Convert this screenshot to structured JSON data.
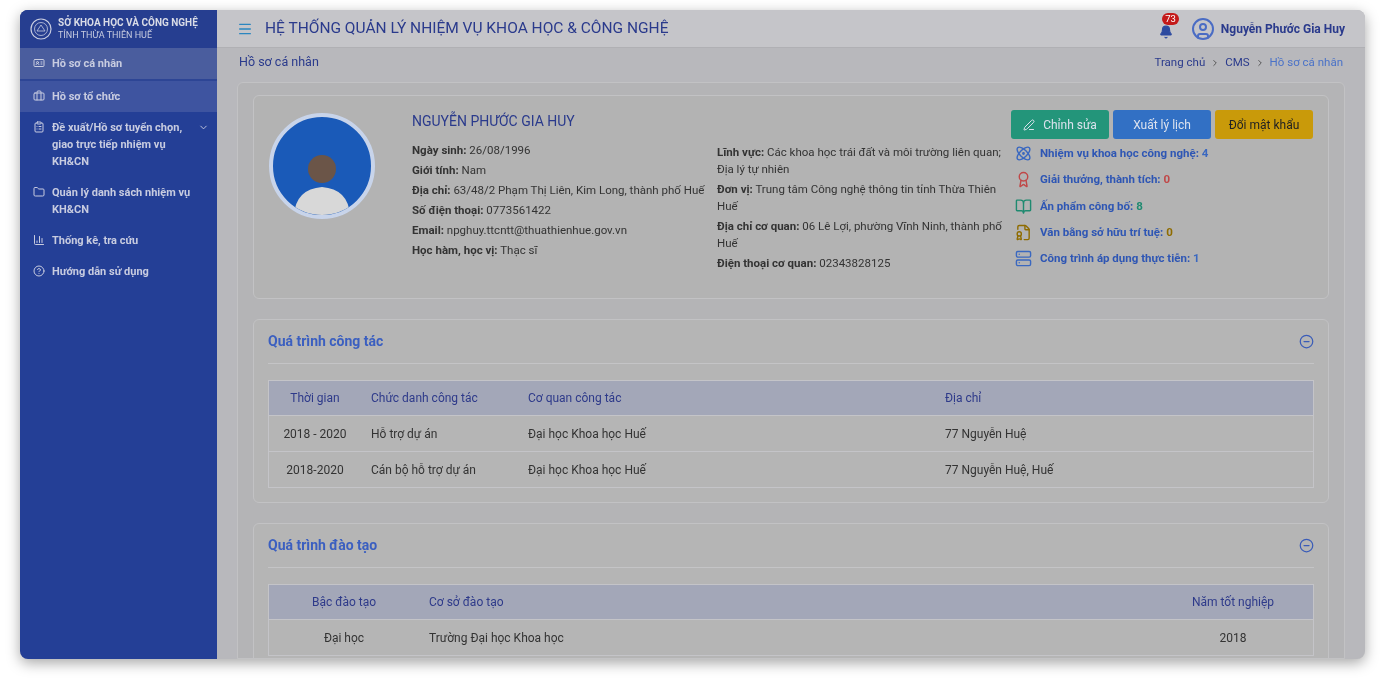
{
  "brand": {
    "line_1": "SỞ KHOA HỌC VÀ CÔNG NGHỆ",
    "line_2": "TỈNH THỪA THIÊN HUẾ"
  },
  "sidebar": {
    "items": [
      {
        "label": "Hồ sơ cá nhân",
        "selected": true,
        "hovered": false,
        "expandable": false
      },
      {
        "label": "Hồ sơ tổ chức",
        "selected": false,
        "hovered": true,
        "expandable": false
      },
      {
        "label": "Đề xuất/Hồ sơ tuyển chọn, giao trực tiếp nhiệm vụ KH&CN",
        "selected": false,
        "hovered": false,
        "expandable": true
      },
      {
        "label": "Quản lý danh sách nhiệm vụ KH&CN",
        "selected": false,
        "hovered": false,
        "expandable": false
      },
      {
        "label": "Thống kê, tra cứu",
        "selected": false,
        "hovered": false,
        "expandable": false
      },
      {
        "label": "Hướng dẫn sử dụng",
        "selected": false,
        "hovered": false,
        "expandable": false
      }
    ]
  },
  "header": {
    "title": "HỆ THỐNG QUẢN LÝ NHIỆM VỤ KHOA HỌC & CÔNG NGHỆ",
    "notification_count": "73",
    "user_name": "Nguyễn Phước Gia Huy"
  },
  "page_title": "Hồ sơ cá nhân",
  "breadcrumb": [
    {
      "label": "Trang chủ",
      "selected": false
    },
    {
      "label": "CMS",
      "selected": false
    },
    {
      "label": "Hồ sơ cá nhân",
      "selected": true
    }
  ],
  "profile": {
    "name": "NGUYỄN PHƯỚC GIA HUY",
    "fields_left": [
      {
        "label": "Ngày sinh:",
        "value": "26/08/1996"
      },
      {
        "label": "Giới tính:",
        "value": "Nam"
      },
      {
        "label": "Địa chỉ:",
        "value": "63/48/2 Phạm Thị Liên, Kim Long, thành phố Huế"
      },
      {
        "label": "Số điện thoại:",
        "value": "0773561422"
      },
      {
        "label": "Email:",
        "value": "npghuy.ttcntt@thuathienhue.gov.vn"
      },
      {
        "label": "Học hàm, học vị:",
        "value": "Thạc sĩ"
      }
    ],
    "fields_right": [
      {
        "label": "Lĩnh vực:",
        "value": "Các khoa học trái đất và môi trường liên quan; Địa lý tự nhiên"
      },
      {
        "label": "Đơn vị:",
        "value": "Trung tâm Công nghệ thông tin tỉnh Thừa Thiên Huế"
      },
      {
        "label": "Địa chỉ cơ quan:",
        "value": "06 Lê Lợi, phường Vĩnh Ninh, thành phố Huế"
      },
      {
        "label": "Điện thoại cơ quan:",
        "value": "02343828125"
      }
    ],
    "buttons": [
      {
        "label": "Chỉnh sửa",
        "kind": "edit",
        "color": "#23957a"
      },
      {
        "label": "Xuất lý lịch",
        "kind": "plain",
        "color": "#3270c4"
      },
      {
        "label": "Đổi mật khẩu",
        "kind": "plain",
        "color": "#c99a0a"
      }
    ],
    "stats": [
      {
        "label": "Nhiệm vụ khoa học công nghệ:",
        "value": "4",
        "color": "#3a68c0"
      },
      {
        "label": "Giải thưởng, thành tích:",
        "value": "0",
        "color": "#c04848"
      },
      {
        "label": "Ấn phẩm công bố:",
        "value": "8",
        "color": "#1f8a70"
      },
      {
        "label": "Văn bằng sở hữu trí tuệ:",
        "value": "0",
        "color": "#8f6c00"
      },
      {
        "label": "Công trình áp dụng thực tiễn:",
        "value": "1",
        "color": "#3a68c0"
      }
    ]
  },
  "sections": [
    {
      "title": "Quá trình công tác",
      "expanded": true,
      "columns": [
        "Thời gian",
        "Chức danh công tác",
        "Cơ quan công tác",
        "Địa chỉ"
      ],
      "rows": [
        [
          "2018 - 2020",
          "Hỗ trợ dự án",
          "Đại học Khoa học Huế",
          "77 Nguyễn Huệ"
        ],
        [
          "2018-2020",
          "Cán bộ hỗ trợ dự án",
          "Đại học Khoa học Huế",
          "77 Nguyễn Huệ, Huế"
        ]
      ]
    },
    {
      "title": "Quá trình đào tạo",
      "expanded": true,
      "columns": [
        "Bậc đào tạo",
        "Cơ sở đào tạo",
        "Năm tốt nghiệp"
      ],
      "rows": [
        [
          "Đại học",
          "Trường Đại học Khoa học",
          "2018"
        ]
      ]
    }
  ]
}
